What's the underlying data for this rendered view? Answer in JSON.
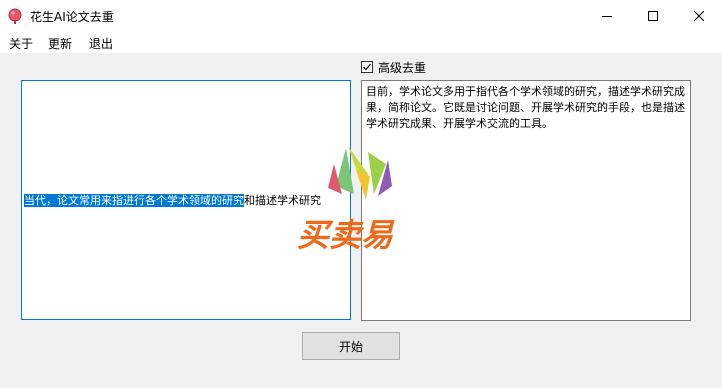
{
  "window": {
    "title": "花生AI论文去重",
    "controls": [
      "minimize",
      "maximize",
      "close"
    ]
  },
  "menu": {
    "items": [
      "关于",
      "更新",
      "退出"
    ]
  },
  "options": {
    "advanced_label": "高级去重",
    "advanced_checked": true
  },
  "input": {
    "selected_text": "当代，论文常用来指进行各个学术领域的研究",
    "rest_text": "和描述学术研究"
  },
  "output": {
    "text": "目前，学术论文多用于指代各个学术领域的研究，描述学术研究成果，简称论文。它既是讨论问题、开展学术研究的手段，也是描述学术研究成果、开展学术交流的工具。"
  },
  "actions": {
    "start_label": "开始"
  },
  "watermark": {
    "text": "买卖易"
  },
  "colors": {
    "accent": "#0078d7",
    "watermark_orange": "#ee6a1a"
  }
}
